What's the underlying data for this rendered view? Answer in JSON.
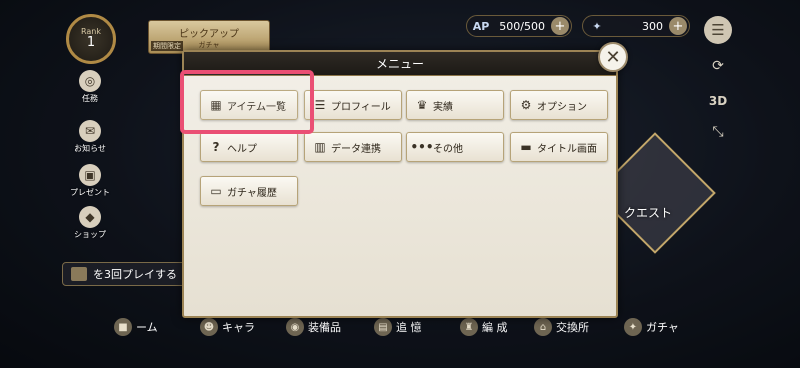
{
  "rank": {
    "label": "Rank",
    "value": "1"
  },
  "pickup_banner": {
    "title": "ピックアップ",
    "subtitle": "ガチャ",
    "tag": "期間限定"
  },
  "resources": {
    "ap": {
      "icon": "AP",
      "value": "500/500",
      "plus": "+"
    },
    "gems": {
      "icon": "✦",
      "value": "300",
      "plus": "+"
    }
  },
  "right_side": {
    "view_3d": "3D"
  },
  "left_menu": [
    {
      "label": "任務",
      "icon": "medal-icon"
    },
    {
      "label": "お知らせ",
      "icon": "mail-icon"
    },
    {
      "label": "プレゼント",
      "icon": "gift-icon"
    },
    {
      "label": "ショップ",
      "icon": "shop-icon"
    }
  ],
  "mission_bar": {
    "text": "を3回プレイする"
  },
  "quest": {
    "label": "クエスト"
  },
  "bottom_nav": [
    {
      "label": "ーム"
    },
    {
      "label": "キャラ"
    },
    {
      "label": "装備品"
    },
    {
      "label": "追 憶"
    },
    {
      "label": "編 成"
    },
    {
      "label": "交換所"
    },
    {
      "label": "ガチャ"
    }
  ],
  "menu": {
    "title": "メニュー",
    "close": "✕",
    "items": [
      {
        "label": "アイテム一覧",
        "icon": "chest-icon"
      },
      {
        "label": "プロフィール",
        "icon": "list-icon"
      },
      {
        "label": "実績",
        "icon": "trophy-icon"
      },
      {
        "label": "オプション",
        "icon": "gear-icon"
      },
      {
        "label": "ヘルプ",
        "icon": "question-icon"
      },
      {
        "label": "データ連携",
        "icon": "data-link-icon"
      },
      {
        "label": "その他",
        "icon": "more-icon"
      },
      {
        "label": "タイトル画面",
        "icon": "title-screen-icon"
      },
      {
        "label": "ガチャ履歴",
        "icon": "ticket-icon"
      }
    ]
  },
  "colors": {
    "highlight": "#ea4f74",
    "accent_gold": "#9c8455"
  }
}
